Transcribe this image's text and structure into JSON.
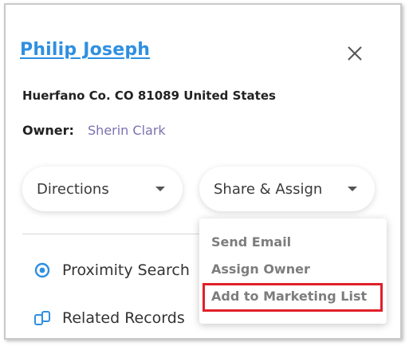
{
  "contact": {
    "name": "Philip Joseph",
    "address": "Huerfano Co. CO 81089 United States",
    "owner_label": "Owner:",
    "owner_name": "Sherin Clark"
  },
  "actions": {
    "directions_label": "Directions",
    "share_assign_label": "Share & Assign"
  },
  "list": {
    "proximity_search": "Proximity Search",
    "related_records": "Related Records"
  },
  "share_menu": {
    "items": [
      "Send Email",
      "Assign Owner",
      "Add to Marketing List"
    ],
    "highlighted": "Add to Marketing List",
    "highlight_color": "#e0202a"
  },
  "icons": {
    "close": "close-icon",
    "caret": "chevron-down-icon",
    "proximity": "target-icon",
    "related": "linked-records-icon"
  },
  "colors": {
    "link": "#2f8fe0",
    "owner_name": "#7a72b0",
    "menu_text": "#7d7d7d"
  }
}
